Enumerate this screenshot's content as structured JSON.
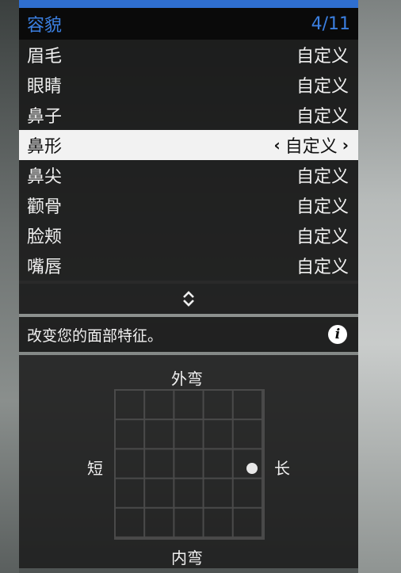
{
  "header": {
    "title": "容貌",
    "page_counter": "4/11"
  },
  "menu_items": [
    {
      "label": "眉毛",
      "value": "自定义",
      "selected": false
    },
    {
      "label": "眼睛",
      "value": "自定义",
      "selected": false
    },
    {
      "label": "鼻子",
      "value": "自定义",
      "selected": false
    },
    {
      "label": "鼻形",
      "value": "自定义",
      "selected": true
    },
    {
      "label": "鼻尖",
      "value": "自定义",
      "selected": false
    },
    {
      "label": "颧骨",
      "value": "自定义",
      "selected": false
    },
    {
      "label": "脸颊",
      "value": "自定义",
      "selected": false
    },
    {
      "label": "嘴唇",
      "value": "自定义",
      "selected": false
    }
  ],
  "icons": {
    "scroll": "up-down-chevron-icon",
    "info": "info-icon",
    "prev": "chevron-left-icon",
    "next": "chevron-right-icon"
  },
  "info": {
    "text": "改变您的面部特征。",
    "icon_glyph": "i"
  },
  "shape_grid": {
    "label_top": "外弯",
    "label_bottom": "内弯",
    "label_left": "短",
    "label_right": "长",
    "marker": {
      "x": 0.85,
      "y": -0.05
    }
  },
  "colors": {
    "accent": "#2f6fd0",
    "header_text": "#3b7fe0",
    "selected_bg": "#f2f2f2"
  }
}
